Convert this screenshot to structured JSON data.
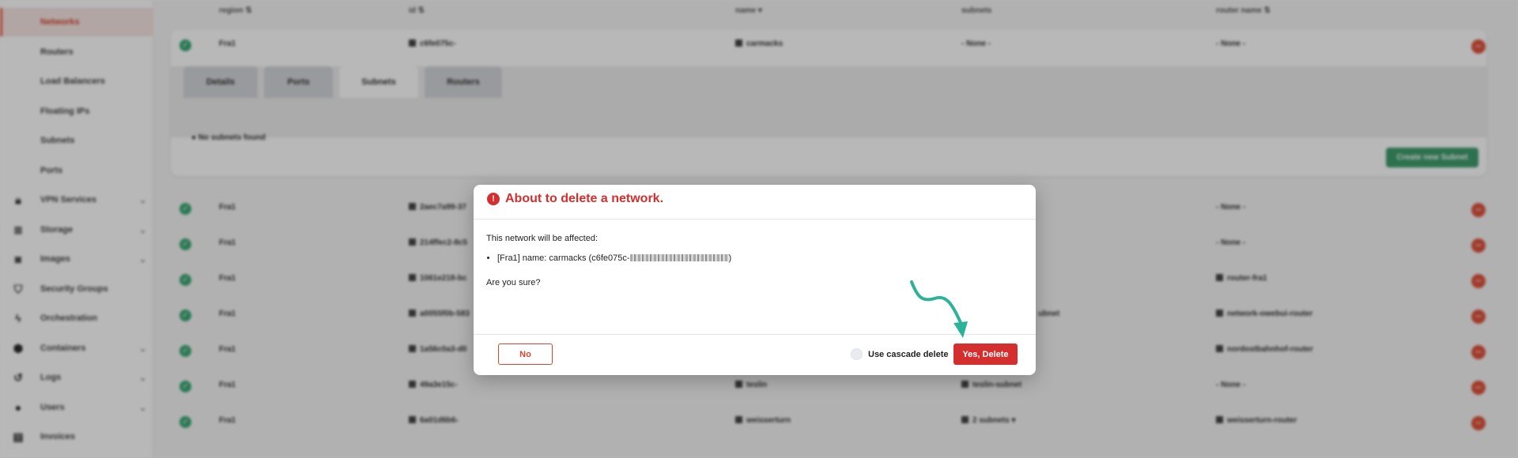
{
  "colors": {
    "accent": "#d42e2e",
    "success": "#3aa876",
    "arrow": "#2bb39a",
    "create_button": "#3f9d6d"
  },
  "sidebar": {
    "subitems": [
      {
        "label": "Networks",
        "active": true
      },
      {
        "label": "Routers"
      },
      {
        "label": "Load Balancers"
      },
      {
        "label": "Floating IPs"
      },
      {
        "label": "Subnets"
      },
      {
        "label": "Ports"
      }
    ],
    "items": [
      {
        "label": "VPN Services",
        "icon": "lock-icon"
      },
      {
        "label": "Storage",
        "icon": "database-icon"
      },
      {
        "label": "Images",
        "icon": "camera-icon"
      },
      {
        "label": "Security Groups",
        "icon": "shield-icon"
      },
      {
        "label": "Orchestration",
        "icon": "orchestration-icon"
      },
      {
        "label": "Containers",
        "icon": "box-icon"
      },
      {
        "label": "Logs",
        "icon": "history-icon"
      },
      {
        "label": "Users",
        "icon": "user-icon"
      },
      {
        "label": "Invoices",
        "icon": "invoice-icon"
      }
    ]
  },
  "table": {
    "headers": {
      "region": "region",
      "id": "id",
      "name": "name",
      "subnets": "subnets",
      "router": "router name"
    },
    "expanded_row": {
      "region": "Fra1",
      "id": "c6fe075c-",
      "name": "carmacks",
      "subnets": "- None -",
      "router": "- None -"
    },
    "tabs": [
      "Details",
      "Ports",
      "Subnets",
      "Routers"
    ],
    "active_tab": "Subnets",
    "no_subnets_text": "No subnets found",
    "create_subnet_label": "Create new Subnet",
    "rows": [
      {
        "region": "Fra1",
        "id": "2aec7a99-37",
        "name": "",
        "subnets": "",
        "router": "- None -"
      },
      {
        "region": "Fra1",
        "id": "214ffec2-8c5",
        "name": "",
        "subnets": "",
        "router": "- None -"
      },
      {
        "region": "Fra1",
        "id": "1061e218-bc",
        "name": "",
        "subnets": "",
        "router": "router-fra1"
      },
      {
        "region": "Fra1",
        "id": "a0055f0b-583",
        "name": "",
        "subnets": "ubnet",
        "router": "network-owebui-router"
      },
      {
        "region": "Fra1",
        "id": "1a56c0a3-d0",
        "name": "",
        "subnets": "",
        "router": "nordostbahnhof-router"
      },
      {
        "region": "Fra1",
        "id": "49a3e15c-",
        "name": "teslin",
        "subnets": "teslin-subnet",
        "router": "- None -"
      },
      {
        "region": "Fra1",
        "id": "6a01d6b6-",
        "name": "weisserturn",
        "subnets": "2 subnets ▾",
        "router": "weisserturn-router"
      }
    ]
  },
  "modal": {
    "title": "About to delete a network.",
    "affected_label": "This network will be affected:",
    "affected_item_prefix": "[Fra1] name: carmacks (c6fe075c-",
    "affected_item_suffix": ")",
    "confirm_text": "Are you sure?",
    "no_label": "No",
    "cascade_label": "Use cascade delete",
    "yes_label": "Yes, Delete"
  }
}
